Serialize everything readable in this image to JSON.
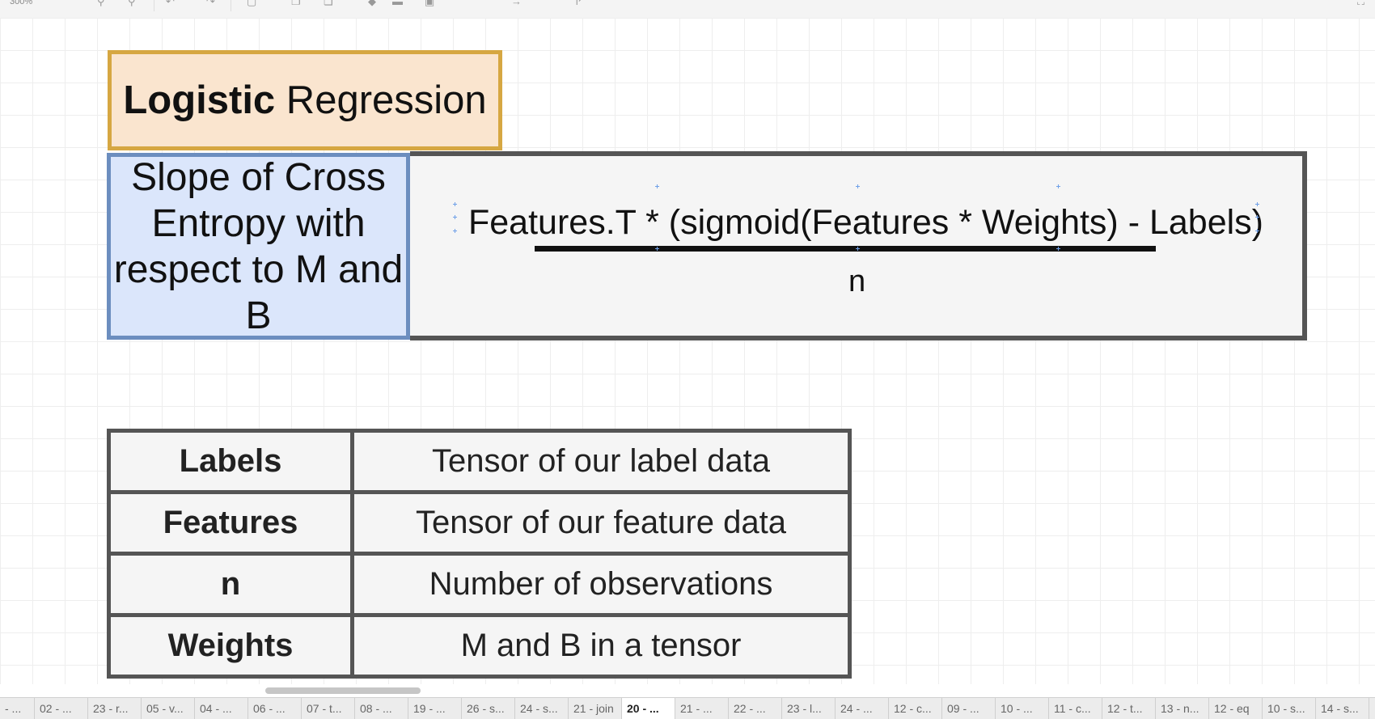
{
  "toolbar": {
    "zoom": "300%"
  },
  "title": {
    "bold": "Logistic",
    "rest": " Regression"
  },
  "slope": {
    "label": "Slope of Cross Entropy with respect to M and B"
  },
  "formula": {
    "numerator": "Features.T * (sigmoid(Features * Weights) - Labels)",
    "denominator": "n"
  },
  "variables": [
    {
      "term": "Labels",
      "desc": "Tensor of our label data"
    },
    {
      "term": "Features",
      "desc": "Tensor of our feature data"
    },
    {
      "term": "n",
      "desc": "Number of observations"
    },
    {
      "term": "Weights",
      "desc": "M and B in a tensor"
    }
  ],
  "tabs": [
    "- ...",
    "02 - ...",
    "23 - r...",
    "05 - v...",
    "04 - ...",
    "06 - ...",
    "07 - t...",
    "08 - ...",
    "19 - ...",
    "26 - s...",
    "24 - s...",
    "21 - join",
    "20 - ...",
    "21 - ...",
    "22 - ...",
    "23 - l...",
    "24 - ...",
    "12 - c...",
    "09 - ...",
    "10 - ...",
    "11 - c...",
    "12 - t...",
    "13 - n...",
    "12 - eq",
    "10 - s...",
    "14 - s..."
  ],
  "active_tab_index": 12
}
